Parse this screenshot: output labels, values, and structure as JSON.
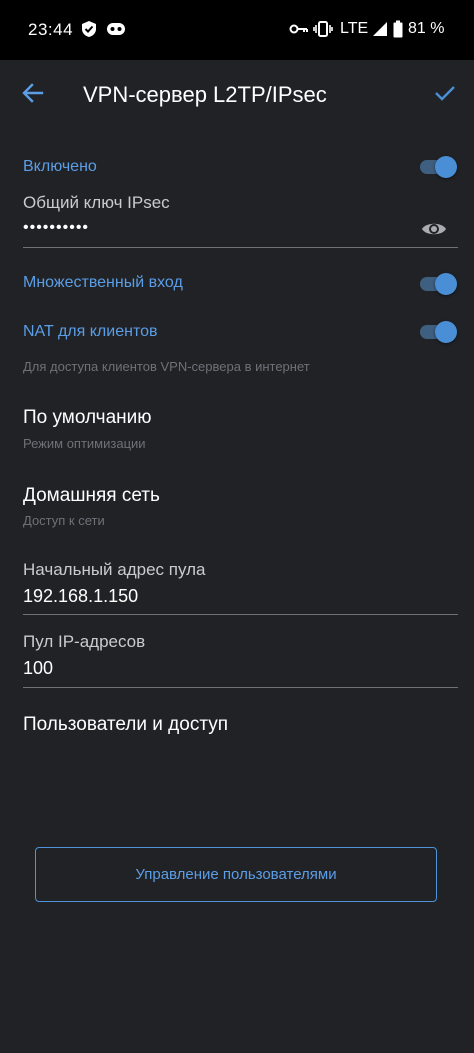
{
  "status_bar": {
    "time": "23:44",
    "network": "LTE",
    "battery": "81 %",
    "icons": [
      "shield-icon",
      "game-controller-icon",
      "key-icon",
      "vibrate-icon",
      "signal-icon",
      "battery-icon"
    ]
  },
  "app_bar": {
    "title": "VPN-сервер L2TP/IPsec",
    "back_icon": "arrow-left-icon",
    "confirm_icon": "check-icon"
  },
  "settings": {
    "enabled": {
      "label": "Включено",
      "on": true
    },
    "ipsec_key": {
      "label": "Общий ключ IPsec",
      "value": "••••••••••"
    },
    "multi_login": {
      "label": "Множественный вход",
      "on": true
    },
    "nat": {
      "label": "NAT для клиентов",
      "on": true,
      "hint": "Для доступа клиентов VPN-сервера в интернет"
    },
    "optimization": {
      "title": "По умолчанию",
      "subtitle": "Режим оптимизации"
    },
    "network": {
      "title": "Домашняя сеть",
      "subtitle": "Доступ к сети"
    },
    "pool_start": {
      "label": "Начальный адрес пула",
      "value": "192.168.1.150"
    },
    "pool_size": {
      "label": "Пул IP-адресов",
      "value": "100"
    },
    "users_section": {
      "title": "Пользователи и доступ"
    },
    "manage_users_button": "Управление пользователями"
  },
  "colors": {
    "background": "#202226",
    "accent": "#5b9ee6",
    "toggle_track": "#3f5f80",
    "toggle_knob": "#4a8fd6"
  }
}
